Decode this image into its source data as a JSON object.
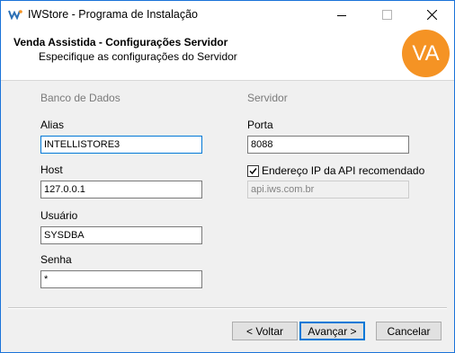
{
  "window": {
    "title": "IWStore - Programa de Instalação"
  },
  "header": {
    "title": "Venda Assistida - Configurações Servidor",
    "subtitle": "Especifique as configurações do Servidor",
    "logo_text": "VA",
    "logo_color": "#f59324"
  },
  "database": {
    "group_label": "Banco de Dados",
    "alias_label": "Alias",
    "alias_value": "INTELLISTORE3",
    "host_label": "Host",
    "host_value": "127.0.0.1",
    "user_label": "Usuário",
    "user_value": "SYSDBA",
    "password_label": "Senha",
    "password_value": "*"
  },
  "server": {
    "group_label": "Servidor",
    "port_label": "Porta",
    "port_value": "8088",
    "api_checkbox_label": "Endereço IP da API recomendado",
    "api_checked": true,
    "api_value": "api.iws.com.br"
  },
  "buttons": {
    "back": "< Voltar",
    "next": "Avançar >",
    "cancel": "Cancelar"
  }
}
